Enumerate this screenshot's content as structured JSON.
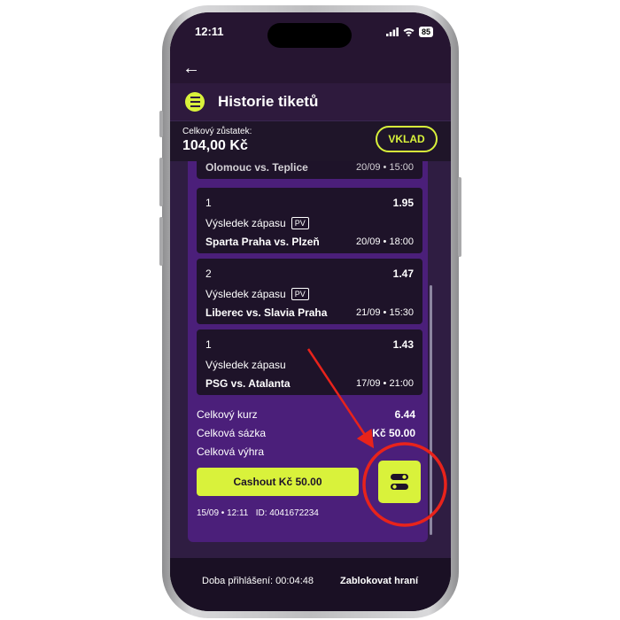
{
  "status_bar": {
    "time": "12:11",
    "battery": "85"
  },
  "header": {
    "title": "Historie tiketů"
  },
  "balance": {
    "label": "Celkový zůstatek:",
    "value": "104,00 Kč",
    "deposit_label": "VKLAD"
  },
  "ticket": {
    "partial_bet": {
      "match": "Olomouc vs. Teplice",
      "date": "20/09 • 15:00"
    },
    "bets": [
      {
        "pick": "1",
        "odds": "1.95",
        "market": "Výsledek zápasu",
        "badge": "PV",
        "match": "Sparta Praha vs. Plzeň",
        "date": "20/09 • 18:00"
      },
      {
        "pick": "2",
        "odds": "1.47",
        "market": "Výsledek zápasu",
        "badge": "PV",
        "match": "Liberec vs. Slavia Praha",
        "date": "21/09 • 15:30"
      },
      {
        "pick": "1",
        "odds": "1.43",
        "market": "Výsledek zápasu",
        "badge": "",
        "match": "PSG vs. Atalanta",
        "date": "17/09 • 21:00"
      }
    ],
    "summary": {
      "total_odds_label": "Celkový kurz",
      "total_odds": "6.44",
      "total_stake_label": "Celková sázka",
      "total_stake": "Kč 50.00",
      "total_win_label": "Celková výhra"
    },
    "cashout_label": "Cashout Kč 50.00",
    "meta": "15/09 • 12:11   ID: 4041672234"
  },
  "bottom_bar": {
    "session": "Doba přihlášení: 00:04:48",
    "block_label": "Zablokovat hraní"
  },
  "colors": {
    "accent": "#d9f23b",
    "background": "#2f1d42",
    "ticket": "#4b1f7a",
    "annotation": "#e8231b"
  }
}
